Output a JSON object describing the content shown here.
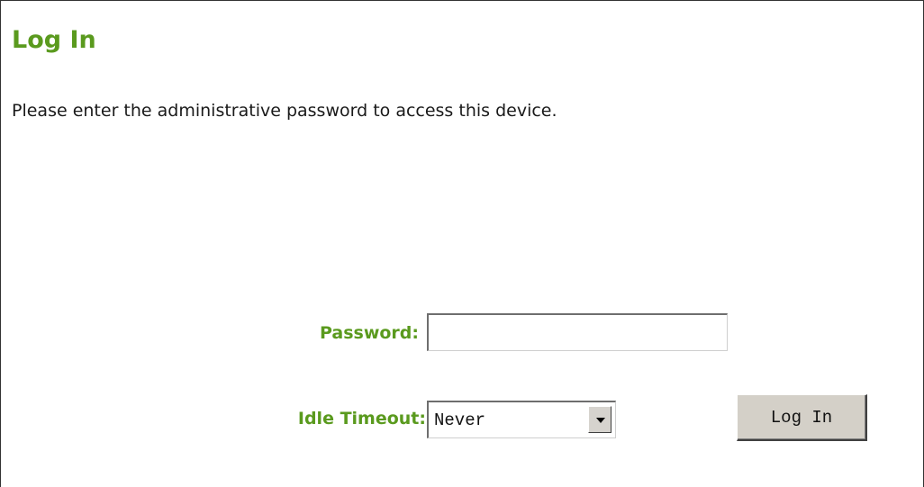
{
  "header": {
    "title": "Log In"
  },
  "main": {
    "instructions": "Please enter the administrative password to access this device."
  },
  "form": {
    "password_label": "Password:",
    "password_value": "",
    "idle_timeout_label": "Idle Timeout:",
    "idle_timeout_selected": "Never",
    "login_button_label": "Log In"
  },
  "colors": {
    "accent": "#5a9a1e",
    "text": "#1a1a1a",
    "button_face": "#d4d0c8"
  },
  "icons": {
    "dropdown": "chevron-down-icon"
  }
}
